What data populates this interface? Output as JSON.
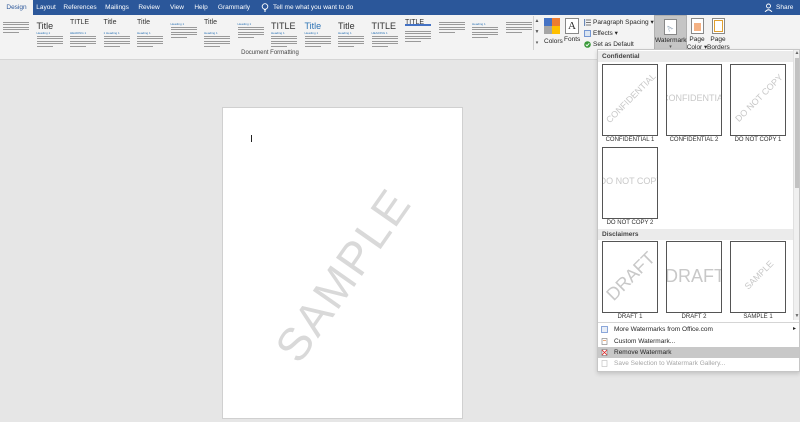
{
  "tabs": [
    {
      "label": "Design",
      "active": true
    },
    {
      "label": "Layout"
    },
    {
      "label": "References"
    },
    {
      "label": "Mailings"
    },
    {
      "label": "Review"
    },
    {
      "label": "View"
    },
    {
      "label": "Help"
    },
    {
      "label": "Grammarly"
    }
  ],
  "tell_me": "Tell me what you want to do",
  "share": "Share",
  "ribbon": {
    "style_thumbs": [
      "",
      "Title",
      "TITLE",
      "Title",
      "Title",
      "",
      "Title",
      "",
      "TITLE",
      "Title",
      "Title",
      "TITLE",
      "TITLE",
      "",
      "",
      ""
    ],
    "thumb_headings": [
      "",
      "Heading 1",
      "HEADING 1",
      "1 Heading 1",
      "Heading 1",
      "Heading 1",
      "Heading 1",
      "Heading 1",
      "Heading 1",
      "Heading 1",
      "Heading 1",
      "HEADING 1",
      "",
      "",
      "Heading 1",
      ""
    ],
    "group_label": "Document Formatting",
    "colors_label": "Colors",
    "fonts_label": "Fonts",
    "fonts_glyph": "A",
    "paragraph_spacing": "Paragraph Spacing",
    "effects": "Effects",
    "set_as_default": "Set as Default",
    "watermark": "Watermark",
    "page_color": [
      "Page",
      "Color"
    ],
    "page_borders": [
      "Page",
      "Borders"
    ]
  },
  "document": {
    "watermark_text": "SAMPLE"
  },
  "watermark_menu": {
    "sections": [
      {
        "header": "Confidential",
        "items": [
          {
            "label": "CONFIDENTIAL 1",
            "preview": "CONFIDENTIAL",
            "diagonal": true
          },
          {
            "label": "CONFIDENTIAL 2",
            "preview": "CONFIDENTIAL",
            "diagonal": false
          },
          {
            "label": "DO NOT COPY 1",
            "preview": "DO NOT COPY",
            "diagonal": true
          },
          {
            "label": "DO NOT COPY 2",
            "preview": "DO NOT COPY",
            "diagonal": false
          }
        ]
      },
      {
        "header": "Disclaimers",
        "items": [
          {
            "label": "DRAFT 1",
            "preview": "DRAFT",
            "diagonal": true
          },
          {
            "label": "DRAFT 2",
            "preview": "DRAFT",
            "diagonal": false
          },
          {
            "label": "SAMPLE 1",
            "preview": "SAMPLE",
            "diagonal": true
          }
        ]
      }
    ],
    "commands": [
      {
        "label": "More Watermarks from Office.com",
        "has_submenu": true
      },
      {
        "label": "Custom Watermark..."
      },
      {
        "label": "Remove Watermark",
        "highlighted": true
      },
      {
        "label": "Save Selection to Watermark Gallery...",
        "disabled": true
      }
    ]
  },
  "colors": {
    "tab_bar": "#2b579a",
    "ribbon": "#f3f3f3",
    "canvas": "#e6e6e6",
    "watermark_gray": "#d9d9d9"
  }
}
